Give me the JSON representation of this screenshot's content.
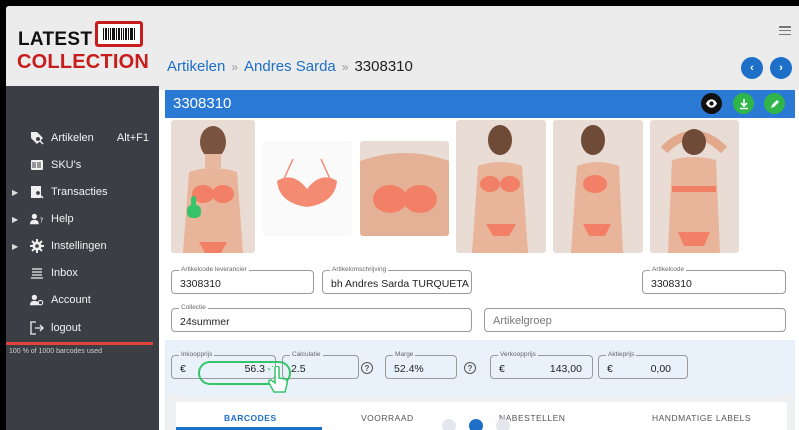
{
  "logo": {
    "line1": "LATEST",
    "line2": "COLLECTION"
  },
  "sidebar": {
    "items": [
      {
        "label": "Artikelen",
        "shortcut": "Alt+F1",
        "icon": "search-tag-icon",
        "expandable": false
      },
      {
        "label": "SKU's",
        "shortcut": "",
        "icon": "barcode-card-icon",
        "expandable": false
      },
      {
        "label": "Transacties",
        "shortcut": "",
        "icon": "receipt-search-icon",
        "expandable": true
      },
      {
        "label": "Help",
        "shortcut": "",
        "icon": "person-question-icon",
        "expandable": true
      },
      {
        "label": "Instellingen",
        "shortcut": "",
        "icon": "gear-icon",
        "expandable": true
      },
      {
        "label": "Inbox",
        "shortcut": "",
        "icon": "inbox-lines-icon",
        "expandable": false
      },
      {
        "label": "Account",
        "shortcut": "",
        "icon": "account-gear-icon",
        "expandable": false
      },
      {
        "label": "logout",
        "shortcut": "",
        "icon": "logout-icon",
        "expandable": false
      }
    ],
    "usage_text": "100 % of 1000 barcodes used",
    "usage_fraction": 1.0
  },
  "header": {
    "breadcrumb": [
      "Artikelen",
      "Andres Sarda",
      "3308310"
    ],
    "separator": "»"
  },
  "title_bar": {
    "title": "3308310"
  },
  "photos_count": 7,
  "form": {
    "supplier_code": {
      "label": "Artikelcode leverancier",
      "value": "3308310"
    },
    "description": {
      "label": "Artikelomschrijving",
      "value": "bh Andres Sarda TURQUETA"
    },
    "article_code": {
      "label": "Artikelcode",
      "value": "3308310"
    },
    "collection": {
      "label": "Collectie",
      "value": "24summer"
    },
    "group": {
      "placeholder": "Artikelgroep"
    }
  },
  "pricing": {
    "purchase": {
      "label": "Inkoopprijs",
      "currency": "€",
      "value": "56.3"
    },
    "calculation": {
      "label": "Calculatie",
      "value": "2.5"
    },
    "margin": {
      "label": "Marge",
      "value": "52.4%"
    },
    "sale": {
      "label": "Verkoopprijs",
      "currency": "€",
      "value": "143,00"
    },
    "promo": {
      "label": "Aktieprijs",
      "currency": "€",
      "value": "0,00"
    },
    "help_glyph": "?"
  },
  "tabs": [
    "BARCODES",
    "VOORRAAD",
    "NABESTELLEN",
    "HANDMATIGE LABELS"
  ],
  "active_tab": "BARCODES",
  "colors": {
    "primary": "#2979d5",
    "brand_red": "#c81d1d",
    "sidebar_bg": "#3b3f45",
    "cursor_green": "#36c46a",
    "save_green": "#2fb54a"
  }
}
